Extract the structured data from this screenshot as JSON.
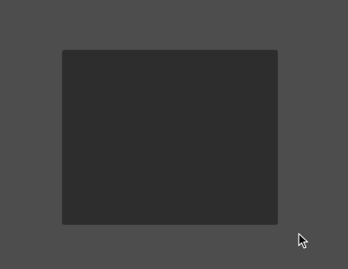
{
  "screen": {
    "background_color": "#4d4d4d"
  },
  "panel": {
    "background_color": "#2d2d2d"
  },
  "cursor": {
    "icon": "arrow-pointer-icon"
  }
}
